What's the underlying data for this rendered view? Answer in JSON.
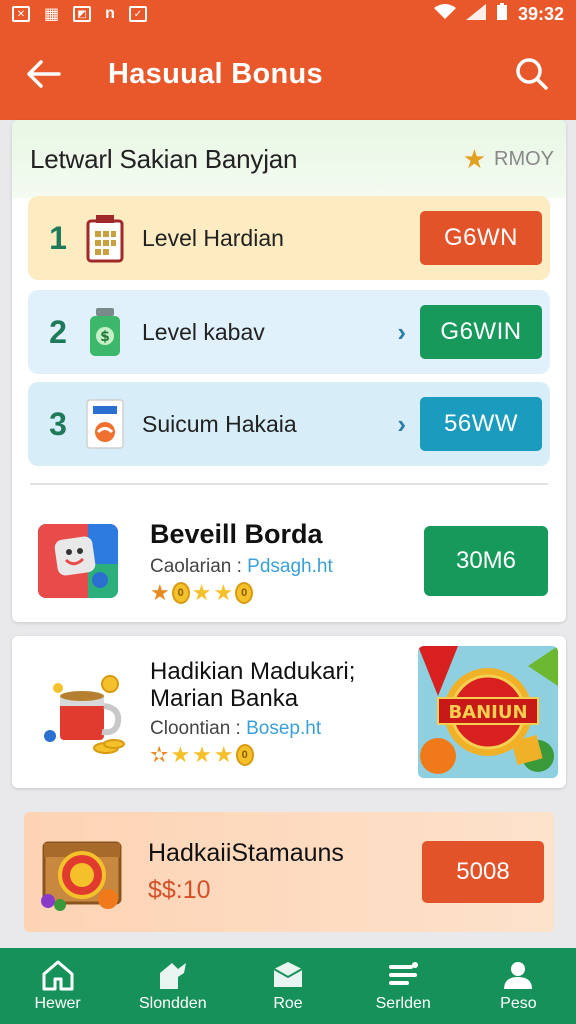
{
  "status_bar": {
    "time": "39:32"
  },
  "header": {
    "title": "Hasuual Bonus"
  },
  "main_card": {
    "title": "Letwarl Sakian Banyjan",
    "badge": "RMOY",
    "levels": [
      {
        "num": "1",
        "label": "Level Hardian",
        "button": "G6WN",
        "button_color": "#e2532a",
        "bg": "#fdebc2"
      },
      {
        "num": "2",
        "label": "Level kabav",
        "button": "G6WIN",
        "button_color": "#16995a",
        "bg": "#e1f1fb"
      },
      {
        "num": "3",
        "label": "Suicum Hakaia",
        "button": "56WW",
        "button_color": "#1b9bbd",
        "bg": "#d7edf7"
      }
    ],
    "featured": {
      "title": "Beveill Borda",
      "sub_label": "Caolarian : ",
      "sub_value": "Pdsagh.ht",
      "button": "30M6"
    }
  },
  "card_two": {
    "title_line1": "Hadikian Madukari;",
    "title_line2": "Marian Banka",
    "sub_label": "Cloontian : ",
    "sub_value": "Bosep.ht",
    "promo_text": "BANIUN"
  },
  "card_three": {
    "title": "HadkaiiStamauns",
    "price": "$$:10",
    "button": "5008"
  },
  "nav": [
    {
      "label": "Hewer",
      "icon": "home-icon"
    },
    {
      "label": "Slondden",
      "icon": "rocket-icon"
    },
    {
      "label": "Roe",
      "icon": "box-icon"
    },
    {
      "label": "Serlden",
      "icon": "list-icon"
    },
    {
      "label": "Peso",
      "icon": "profile-icon"
    }
  ],
  "colors": {
    "brand": "#e8582a",
    "nav": "#17915a",
    "green": "#16995a",
    "orange": "#e2532a"
  }
}
